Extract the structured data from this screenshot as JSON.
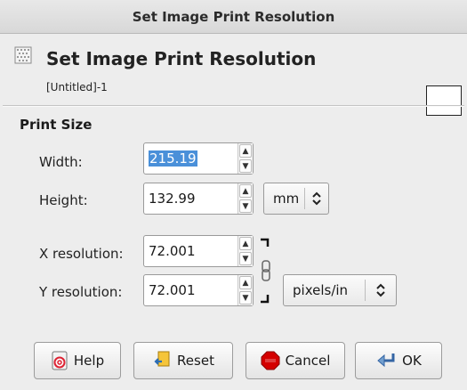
{
  "window": {
    "title": "Set Image Print Resolution"
  },
  "header": {
    "title": "Set Image Print Resolution",
    "subtitle": "[Untitled]-1",
    "icon": "print-resolution-icon"
  },
  "print_size": {
    "section_label": "Print Size",
    "width": {
      "label": "Width:",
      "value": "215.19",
      "selected": true
    },
    "height": {
      "label": "Height:",
      "value": "132.99"
    },
    "size_unit": "mm",
    "x_resolution": {
      "label": "X resolution:",
      "value": "72.001"
    },
    "y_resolution": {
      "label": "Y resolution:",
      "value": "72.001"
    },
    "resolution_unit": "pixels/in",
    "chain_linked": true
  },
  "buttons": {
    "help": "Help",
    "reset": "Reset",
    "cancel": "Cancel",
    "ok": "OK"
  },
  "colors": {
    "selection": "#4a90d9",
    "cancel_icon": "#d40000",
    "background": "#ededed"
  }
}
